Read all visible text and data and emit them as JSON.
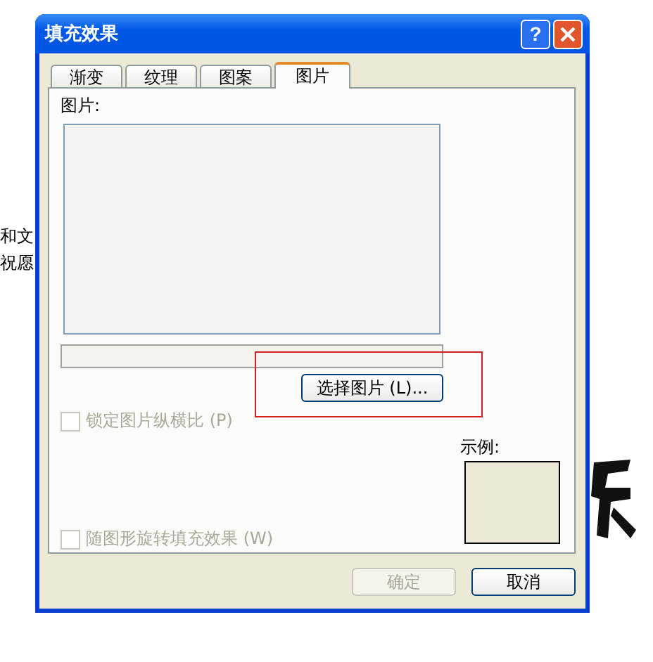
{
  "window": {
    "title": "填充效果",
    "help_button": "?"
  },
  "background_text": [
    "和文",
    "祝愿"
  ],
  "tabs": [
    {
      "label": "渐变",
      "selected": false
    },
    {
      "label": "纹理",
      "selected": false
    },
    {
      "label": "图案",
      "selected": false
    },
    {
      "label": "图片",
      "selected": true
    }
  ],
  "picture_label": "图片:",
  "select_button": "选择图片 (L)...",
  "checkboxes": [
    {
      "label": "锁定图片纵横比 (P)",
      "checked": false,
      "disabled": true
    },
    {
      "label": "随图形旋转填充效果 (W)",
      "checked": false,
      "disabled": true
    }
  ],
  "sample_label": "示例:",
  "buttons": [
    {
      "label": "确定",
      "disabled": true
    },
    {
      "label": "取消",
      "disabled": false
    }
  ]
}
